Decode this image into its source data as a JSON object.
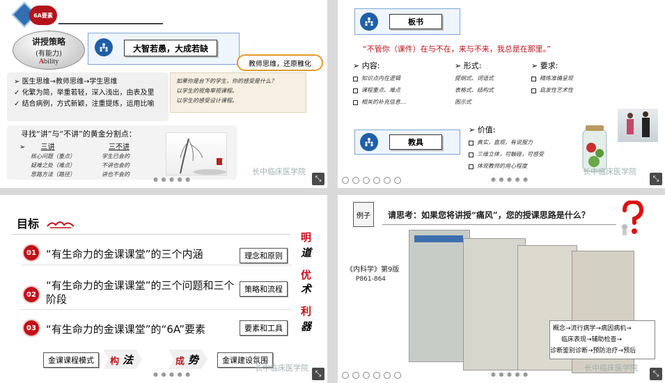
{
  "slide1": {
    "logo_text": "6A要素",
    "strategy_title": "讲授策略",
    "strategy_sub": "(有能力)",
    "strategy_eng_first": "A",
    "strategy_eng_rest": "bility",
    "motto": "大智若愚，大成若缺",
    "callout": "教师思维，还原稚化",
    "bullets": [
      "医生思维→教师思维→学生思维",
      "化繁为简，举重若轻，深入浅出，由表及里",
      "结合病例，方式新颖，注重提炼，运用比喻"
    ],
    "notes": [
      "如果你是台下的学生，你的感受是什么？",
      "以学生的视角审视课程。",
      "以学生的感受设计课程。"
    ],
    "gold_title": "寻找“讲”与“不讲”的黄金分割点：",
    "col_speak": "三讲",
    "col_nospeak": "三不讲",
    "speak_items": [
      "核心问题（重点）",
      "疑难之处（难点）",
      "思路方法（路径）"
    ],
    "nospeak_items": [
      "学生已会的",
      "不讲也会的",
      "讲也不会的"
    ],
    "watermark": "长中临床医学院"
  },
  "slide2": {
    "board_label": "板书",
    "quote": "“不管你（课件）在与不在，来与不来，我总是在那里。”",
    "content_head": "内容:",
    "content_items": [
      "知识点内在逻辑",
      "课程重点、难点",
      "相关的补充信息…"
    ],
    "form_head": "形式:",
    "form_items": [
      "提纲式、词语式",
      "表格式、结构式",
      "图示式"
    ],
    "req_head": "要求:",
    "req_items": [
      "精炼准确呈现",
      "启发性艺术性"
    ],
    "tool_label": "教具",
    "value_head": "价值:",
    "value_items": [
      "真实，直观，有说服力",
      "三维立体，可触碰，可感受",
      "体现教师的用心程度"
    ],
    "watermark": "长中临床医学院"
  },
  "slide3": {
    "title": "目标",
    "items": [
      {
        "num": "01",
        "text": "“有生命力的金课课堂”的三个内涵",
        "tag": "理念和原则"
      },
      {
        "num": "02",
        "text": "“有生命力的金课课堂”的三个问题和三个阶段",
        "tag": "策略和流程"
      },
      {
        "num": "03",
        "text": "“有生命力的金课课堂”的“6A”要素",
        "tag": "要素和工具"
      }
    ],
    "side_chars": [
      "明",
      "道",
      "优",
      "术",
      "利",
      "器"
    ],
    "bottom_left": "金课课程模式",
    "bottom_mid1": "构",
    "bottom_mid2": "法",
    "bottom_mid3": "成",
    "bottom_mid4": "势",
    "bottom_right": "金课建设氛围",
    "watermark": "长中临床医学院"
  },
  "slide4": {
    "example": "例子",
    "question": "请思考：如果您将讲授“痛风”，您的授课思路是什么？",
    "book": "《内科学》第9版",
    "pages": "P861-864",
    "flow": [
      "概念→流行病学→病因病机→",
      "临床表现→辅助检查→",
      "诊断鉴别诊断→预防治疗→预后"
    ],
    "watermark": "长中临床医学院"
  }
}
